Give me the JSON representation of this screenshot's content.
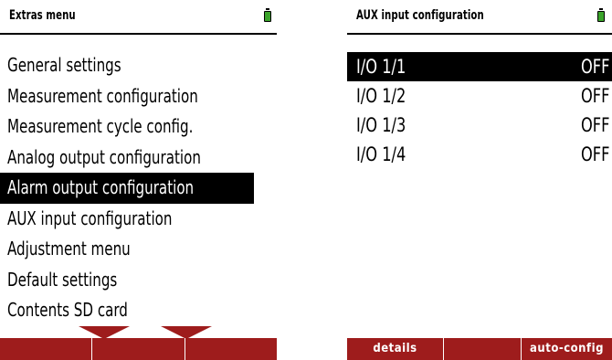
{
  "left": {
    "title": "Extras menu",
    "items": [
      "General settings",
      "Measurement configuration",
      "Measurement cycle config.",
      "Analog output configuration",
      "Alarm output configuration",
      "AUX input configuration",
      "Adjustment menu",
      "Default settings",
      "Contents SD card"
    ],
    "selected_item": "Alarm output configuration",
    "softkeys": [
      "",
      "",
      ""
    ]
  },
  "right": {
    "title": "AUX input configuration",
    "rows": [
      {
        "name": "I/O 1/1",
        "value": "OFF"
      },
      {
        "name": "I/O 1/2",
        "value": "OFF"
      },
      {
        "name": "I/O 1/3",
        "value": "OFF"
      },
      {
        "name": "I/O 1/4",
        "value": "OFF"
      }
    ],
    "selected_row": "I/O 1/1",
    "softkeys": [
      "details",
      "",
      "auto-config"
    ]
  },
  "colors": {
    "softkey_bar": "#9e1c1c",
    "battery": "#3aa32a",
    "selection": "#000000"
  }
}
